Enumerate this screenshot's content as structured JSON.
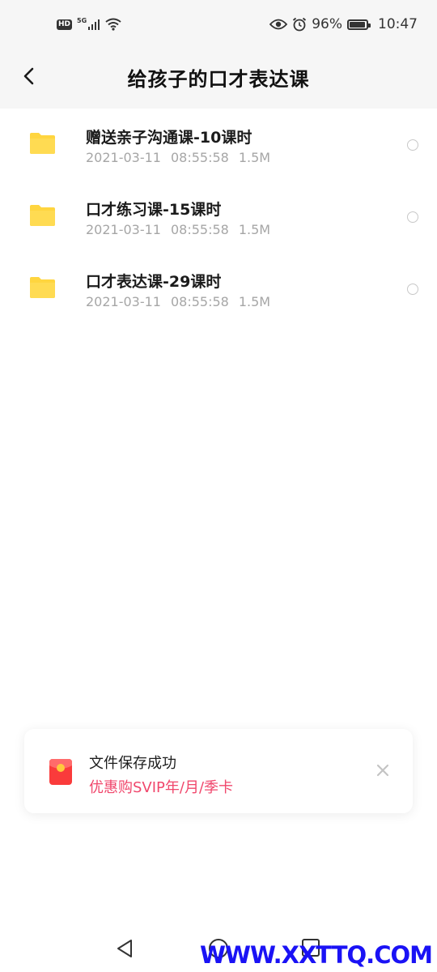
{
  "status_bar": {
    "network_badge": "HD",
    "network_type": "5G",
    "battery_percent": "96%",
    "battery_level": 0.96,
    "time": "10:47"
  },
  "header": {
    "title": "给孩子的口才表达课"
  },
  "files": [
    {
      "name": "赠送亲子沟通课-10课时",
      "date": "2021-03-11",
      "time": "08:55:58",
      "size": "1.5M"
    },
    {
      "name": "口才练习课-15课时",
      "date": "2021-03-11",
      "time": "08:55:58",
      "size": "1.5M"
    },
    {
      "name": "口才表达课-29课时",
      "date": "2021-03-11",
      "time": "08:55:58",
      "size": "1.5M"
    }
  ],
  "toast": {
    "title": "文件保存成功",
    "promo": "优惠购SVIP年/月/季卡"
  },
  "watermark": "WWW.XXTTQ.COM",
  "colors": {
    "folder": "#FFD53F",
    "promo": "#F0476C",
    "watermark": "#1A12F5",
    "header_bg": "#F6F6F6"
  }
}
